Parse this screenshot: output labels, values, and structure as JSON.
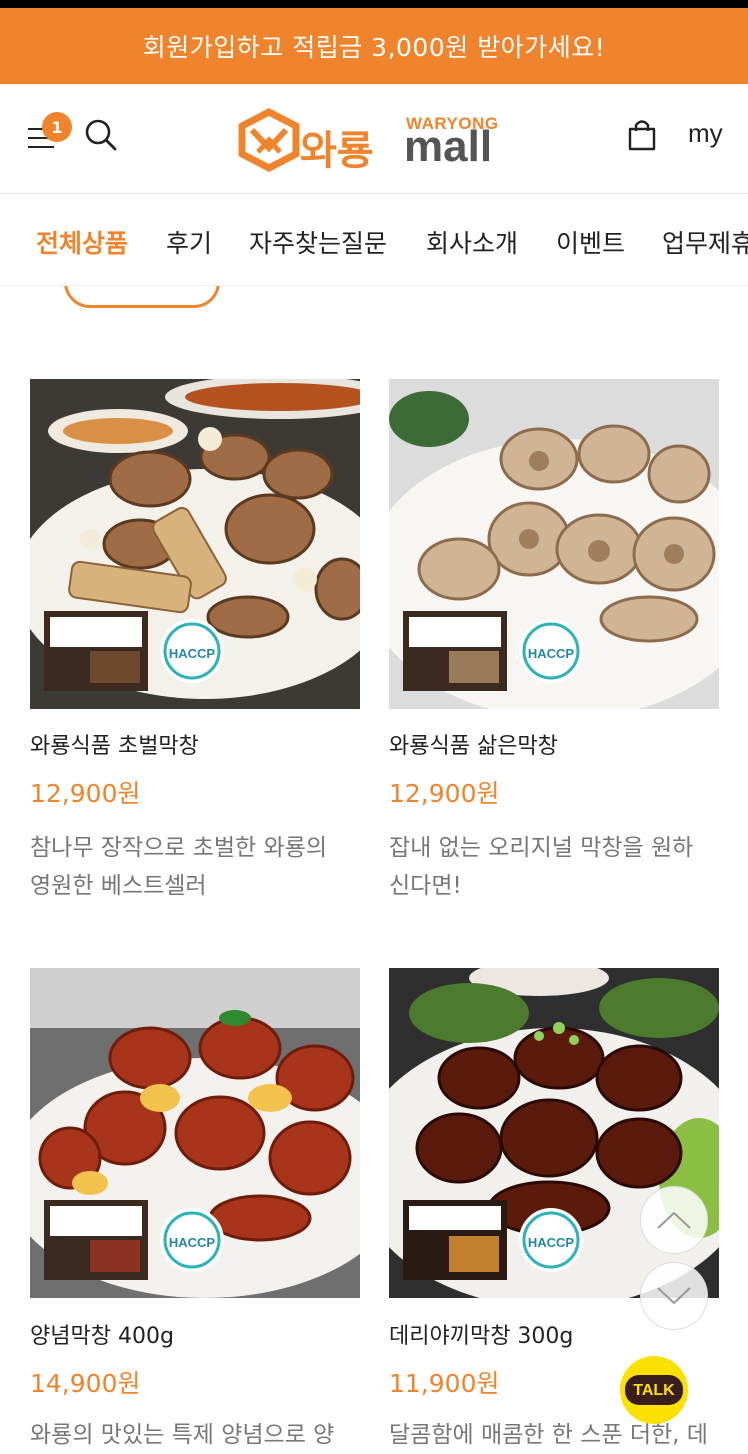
{
  "promo": {
    "text": "회원가입하고 적립금 3,000원 받아가세요!"
  },
  "header": {
    "menu_badge": "1",
    "logo_korean": "와룡",
    "logo_english": "WARYONG",
    "logo_mall": "mall",
    "my_label": "my"
  },
  "nav": {
    "tabs": [
      {
        "label": "전체상품"
      },
      {
        "label": "후기"
      },
      {
        "label": "자주찾는질문"
      },
      {
        "label": "회사소개"
      },
      {
        "label": "이벤트"
      },
      {
        "label": "업무제휴"
      }
    ]
  },
  "products": [
    {
      "name": "와룡식품 초벌막창",
      "price": "12,900원",
      "desc_line1": "참나무 장작으로 초벌한 와룡의",
      "desc_line2": "영원한 베스트셀러",
      "badge": "HACCP"
    },
    {
      "name": "와룡식품 삶은막창",
      "price": "12,900원",
      "desc_line1": "잡내 없는 오리지널 막창을 원하",
      "desc_line2": "신다면!",
      "badge": "HACCP"
    },
    {
      "name": "양념막창 400g",
      "price": "14,900원",
      "desc_line1": "와룡의 맛있는 특제 양념으로 양",
      "desc_line2": "",
      "badge": "HACCP"
    },
    {
      "name": "데리야끼막창 300g",
      "price": "11,900원",
      "desc_line1": "달콤함에 매콤한 한 스푼 더한, 데",
      "desc_line2": "",
      "badge": "HACCP"
    }
  ],
  "floating": {
    "talk_label": "TALK"
  },
  "colors": {
    "accent": "#f0842c",
    "talk": "#fae100"
  }
}
